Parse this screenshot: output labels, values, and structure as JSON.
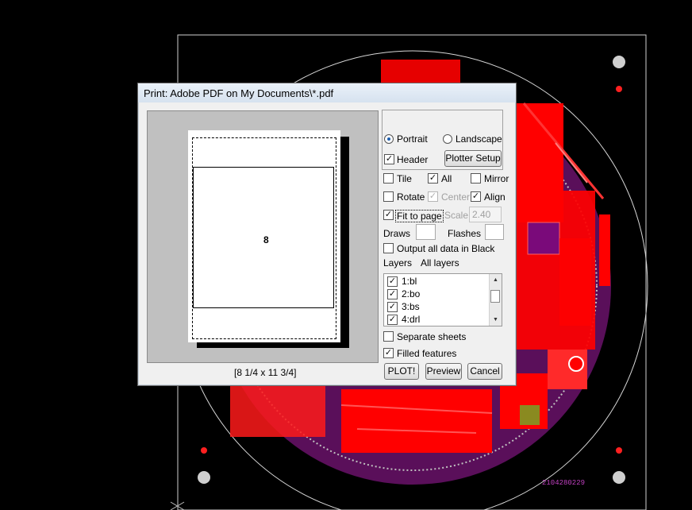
{
  "pcb": {
    "label": "2104280229"
  },
  "dialog": {
    "title": "Print: Adobe PDF on My Documents\\*.pdf",
    "preview": {
      "page_number": "8",
      "paper_size": "[8 1/4 x 11 3/4]"
    },
    "orientation": {
      "portrait_label": "Portrait",
      "landscape_label": "Landscape",
      "selected": "Portrait"
    },
    "header": {
      "label": "Header",
      "checked": true
    },
    "plotter_setup_label": "Plotter Setup",
    "options": {
      "tile": {
        "label": "Tile",
        "checked": false
      },
      "all": {
        "label": "All",
        "checked": true
      },
      "mirror": {
        "label": "Mirror",
        "checked": false
      },
      "rotate": {
        "label": "Rotate",
        "checked": false
      },
      "center": {
        "label": "Center",
        "checked": true,
        "disabled": true
      },
      "align": {
        "label": "Align",
        "checked": true
      },
      "fit_to_page": {
        "label": "Fit to page",
        "checked": true
      },
      "scale_label": "Scale",
      "scale_value": "2.40"
    },
    "draws_label": "Draws",
    "flashes_label": "Flashes",
    "output_black": {
      "label": "Output all data in Black",
      "checked": false
    },
    "layers_label": "Layers",
    "all_layers_label": "All layers",
    "layers": [
      {
        "name": "1:bl",
        "checked": true
      },
      {
        "name": "2:bo",
        "checked": true
      },
      {
        "name": "3:bs",
        "checked": true
      },
      {
        "name": "4:drl",
        "checked": true
      }
    ],
    "separate_sheets": {
      "label": "Separate sheets",
      "checked": false
    },
    "filled_features": {
      "label": "Filled features",
      "checked": true
    },
    "buttons": {
      "plot": "PLOT!",
      "preview": "Preview",
      "cancel": "Cancel"
    }
  },
  "colors": {
    "pcb_red": "#ff0000",
    "pcb_purple": "#8c1a8c",
    "arrow": "#e8181e",
    "title_bar": "#dce6f2"
  }
}
